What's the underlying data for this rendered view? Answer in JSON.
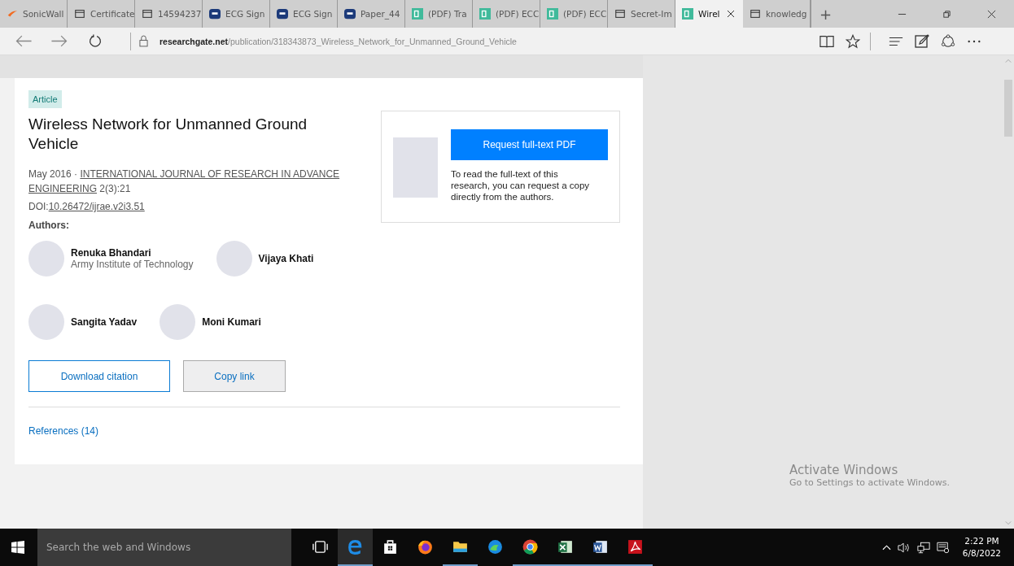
{
  "browser": {
    "tabs": [
      {
        "label": "SonicWall",
        "kind": "sonicwall",
        "selected": false
      },
      {
        "label": "Certificate",
        "kind": "page",
        "selected": false
      },
      {
        "label": "14594237",
        "kind": "page",
        "selected": false
      },
      {
        "label": "ECG Sign",
        "kind": "sai",
        "selected": false
      },
      {
        "label": "ECG Sign",
        "kind": "sai",
        "selected": false
      },
      {
        "label": "Paper_44",
        "kind": "sai",
        "selected": false
      },
      {
        "label": "(PDF) Tra",
        "kind": "rg",
        "selected": false
      },
      {
        "label": "(PDF) ECC",
        "kind": "rg",
        "selected": false
      },
      {
        "label": "(PDF) ECC",
        "kind": "rg",
        "selected": false
      },
      {
        "label": "Secret-Im",
        "kind": "page",
        "selected": false
      },
      {
        "label": "Wirel",
        "kind": "rg",
        "selected": true
      },
      {
        "label": "knowledg",
        "kind": "page",
        "selected": false
      }
    ],
    "new_tab": "+",
    "url": {
      "domain": "researchgate.net",
      "path": "/publication/318343873_Wireless_Network_for_Unmanned_Ground_Vehicle"
    }
  },
  "page": {
    "badge": "Article",
    "title": "Wireless Network for Unmanned Ground Vehicle",
    "date": "May 2016 · ",
    "journal": "INTERNATIONAL JOURNAL OF RESEARCH IN ADVANCE ENGINEERING",
    "issue": " 2(3):21",
    "doi_label": "DOI:",
    "doi": "10.26472/ijrae.v2i3.51",
    "authors_label": "Authors:",
    "authors": [
      {
        "name": "Renuka Bhandari",
        "affiliation": "Army Institute of Technology"
      },
      {
        "name": "Vijaya Khati"
      },
      {
        "name": "Sangita Yadav"
      },
      {
        "name": "Moni Kumari"
      }
    ],
    "buttons": [
      {
        "label": "Download citation",
        "kind": "outline"
      },
      {
        "label": "Copy link",
        "kind": "grey"
      }
    ],
    "references": "References (14)",
    "request": {
      "button": "Request full-text PDF",
      "text": "To read the full-text of this research, you can request a copy directly from the authors."
    }
  },
  "activation": {
    "title": "Activate Windows",
    "subtitle": "Go to Settings to activate Windows."
  },
  "taskbar": {
    "search_placeholder": "Search the web and Windows",
    "apps": [
      {
        "kind": "taskview",
        "running": false,
        "selected": false
      },
      {
        "kind": "edge",
        "running": true,
        "selected": true
      },
      {
        "kind": "store",
        "running": false,
        "selected": false
      },
      {
        "kind": "firefox",
        "running": false,
        "selected": false
      },
      {
        "kind": "files",
        "running": true,
        "selected": false
      },
      {
        "kind": "newedge",
        "running": false,
        "selected": false
      },
      {
        "kind": "chrome",
        "running": true,
        "selected": false
      },
      {
        "kind": "excel",
        "running": true,
        "selected": false
      },
      {
        "kind": "word",
        "running": true,
        "selected": false
      },
      {
        "kind": "acrobat",
        "running": true,
        "selected": false
      }
    ],
    "time": "2:22 PM",
    "date": "6/8/2022"
  }
}
